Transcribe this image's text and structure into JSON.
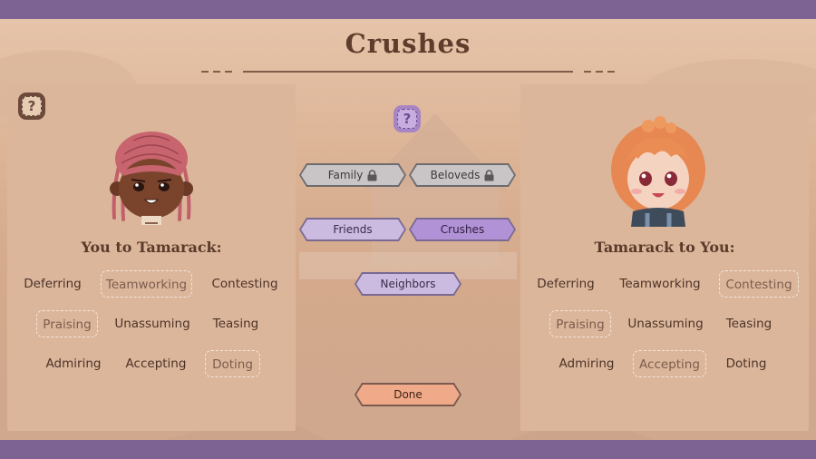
{
  "screen": {
    "title": "Crushes"
  },
  "left_panel": {
    "heading": "You to Tamarack:",
    "help_label": "?",
    "traits": [
      {
        "label": "Deferring",
        "selected": false
      },
      {
        "label": "Teamworking",
        "selected": true
      },
      {
        "label": "Contesting",
        "selected": false
      },
      {
        "label": "Praising",
        "selected": true
      },
      {
        "label": "Unassuming",
        "selected": false
      },
      {
        "label": "Teasing",
        "selected": false
      },
      {
        "label": "Admiring",
        "selected": false
      },
      {
        "label": "Accepting",
        "selected": false
      },
      {
        "label": "Doting",
        "selected": true
      }
    ]
  },
  "right_panel": {
    "heading": "Tamarack to You:",
    "traits": [
      {
        "label": "Deferring",
        "selected": false
      },
      {
        "label": "Teamworking",
        "selected": false
      },
      {
        "label": "Contesting",
        "selected": true
      },
      {
        "label": "Praising",
        "selected": true
      },
      {
        "label": "Unassuming",
        "selected": false
      },
      {
        "label": "Teasing",
        "selected": false
      },
      {
        "label": "Admiring",
        "selected": false
      },
      {
        "label": "Accepting",
        "selected": true
      },
      {
        "label": "Doting",
        "selected": false
      }
    ]
  },
  "center": {
    "help_label": "?",
    "categories": {
      "family": {
        "label": "Family",
        "locked": true
      },
      "beloveds": {
        "label": "Beloveds",
        "locked": true
      },
      "friends": {
        "label": "Friends",
        "locked": false
      },
      "crushes": {
        "label": "Crushes",
        "locked": false,
        "active": true
      },
      "neighbors": {
        "label": "Neighbors",
        "locked": false
      }
    },
    "done_label": "Done"
  },
  "colors": {
    "frame_bar": "#7d6394",
    "panel": "#dcb69b",
    "active_tab": "#b292d6",
    "done_button": "#f0a989"
  }
}
